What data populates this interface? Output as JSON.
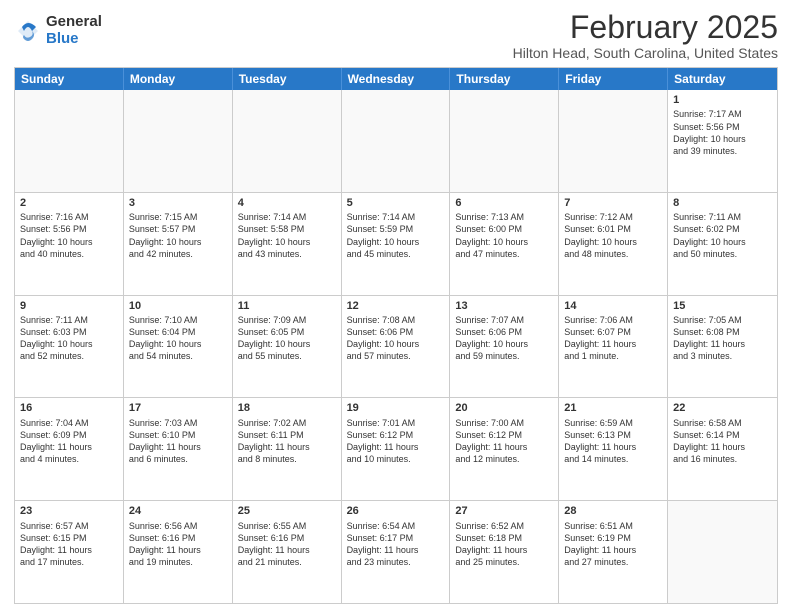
{
  "header": {
    "logo": {
      "general": "General",
      "blue": "Blue"
    },
    "month": "February 2025",
    "location": "Hilton Head, South Carolina, United States"
  },
  "weekdays": [
    "Sunday",
    "Monday",
    "Tuesday",
    "Wednesday",
    "Thursday",
    "Friday",
    "Saturday"
  ],
  "rows": [
    [
      {
        "day": "",
        "info": ""
      },
      {
        "day": "",
        "info": ""
      },
      {
        "day": "",
        "info": ""
      },
      {
        "day": "",
        "info": ""
      },
      {
        "day": "",
        "info": ""
      },
      {
        "day": "",
        "info": ""
      },
      {
        "day": "1",
        "info": "Sunrise: 7:17 AM\nSunset: 5:56 PM\nDaylight: 10 hours\nand 39 minutes."
      }
    ],
    [
      {
        "day": "2",
        "info": "Sunrise: 7:16 AM\nSunset: 5:56 PM\nDaylight: 10 hours\nand 40 minutes."
      },
      {
        "day": "3",
        "info": "Sunrise: 7:15 AM\nSunset: 5:57 PM\nDaylight: 10 hours\nand 42 minutes."
      },
      {
        "day": "4",
        "info": "Sunrise: 7:14 AM\nSunset: 5:58 PM\nDaylight: 10 hours\nand 43 minutes."
      },
      {
        "day": "5",
        "info": "Sunrise: 7:14 AM\nSunset: 5:59 PM\nDaylight: 10 hours\nand 45 minutes."
      },
      {
        "day": "6",
        "info": "Sunrise: 7:13 AM\nSunset: 6:00 PM\nDaylight: 10 hours\nand 47 minutes."
      },
      {
        "day": "7",
        "info": "Sunrise: 7:12 AM\nSunset: 6:01 PM\nDaylight: 10 hours\nand 48 minutes."
      },
      {
        "day": "8",
        "info": "Sunrise: 7:11 AM\nSunset: 6:02 PM\nDaylight: 10 hours\nand 50 minutes."
      }
    ],
    [
      {
        "day": "9",
        "info": "Sunrise: 7:11 AM\nSunset: 6:03 PM\nDaylight: 10 hours\nand 52 minutes."
      },
      {
        "day": "10",
        "info": "Sunrise: 7:10 AM\nSunset: 6:04 PM\nDaylight: 10 hours\nand 54 minutes."
      },
      {
        "day": "11",
        "info": "Sunrise: 7:09 AM\nSunset: 6:05 PM\nDaylight: 10 hours\nand 55 minutes."
      },
      {
        "day": "12",
        "info": "Sunrise: 7:08 AM\nSunset: 6:06 PM\nDaylight: 10 hours\nand 57 minutes."
      },
      {
        "day": "13",
        "info": "Sunrise: 7:07 AM\nSunset: 6:06 PM\nDaylight: 10 hours\nand 59 minutes."
      },
      {
        "day": "14",
        "info": "Sunrise: 7:06 AM\nSunset: 6:07 PM\nDaylight: 11 hours\nand 1 minute."
      },
      {
        "day": "15",
        "info": "Sunrise: 7:05 AM\nSunset: 6:08 PM\nDaylight: 11 hours\nand 3 minutes."
      }
    ],
    [
      {
        "day": "16",
        "info": "Sunrise: 7:04 AM\nSunset: 6:09 PM\nDaylight: 11 hours\nand 4 minutes."
      },
      {
        "day": "17",
        "info": "Sunrise: 7:03 AM\nSunset: 6:10 PM\nDaylight: 11 hours\nand 6 minutes."
      },
      {
        "day": "18",
        "info": "Sunrise: 7:02 AM\nSunset: 6:11 PM\nDaylight: 11 hours\nand 8 minutes."
      },
      {
        "day": "19",
        "info": "Sunrise: 7:01 AM\nSunset: 6:12 PM\nDaylight: 11 hours\nand 10 minutes."
      },
      {
        "day": "20",
        "info": "Sunrise: 7:00 AM\nSunset: 6:12 PM\nDaylight: 11 hours\nand 12 minutes."
      },
      {
        "day": "21",
        "info": "Sunrise: 6:59 AM\nSunset: 6:13 PM\nDaylight: 11 hours\nand 14 minutes."
      },
      {
        "day": "22",
        "info": "Sunrise: 6:58 AM\nSunset: 6:14 PM\nDaylight: 11 hours\nand 16 minutes."
      }
    ],
    [
      {
        "day": "23",
        "info": "Sunrise: 6:57 AM\nSunset: 6:15 PM\nDaylight: 11 hours\nand 17 minutes."
      },
      {
        "day": "24",
        "info": "Sunrise: 6:56 AM\nSunset: 6:16 PM\nDaylight: 11 hours\nand 19 minutes."
      },
      {
        "day": "25",
        "info": "Sunrise: 6:55 AM\nSunset: 6:16 PM\nDaylight: 11 hours\nand 21 minutes."
      },
      {
        "day": "26",
        "info": "Sunrise: 6:54 AM\nSunset: 6:17 PM\nDaylight: 11 hours\nand 23 minutes."
      },
      {
        "day": "27",
        "info": "Sunrise: 6:52 AM\nSunset: 6:18 PM\nDaylight: 11 hours\nand 25 minutes."
      },
      {
        "day": "28",
        "info": "Sunrise: 6:51 AM\nSunset: 6:19 PM\nDaylight: 11 hours\nand 27 minutes."
      },
      {
        "day": "",
        "info": ""
      }
    ]
  ]
}
